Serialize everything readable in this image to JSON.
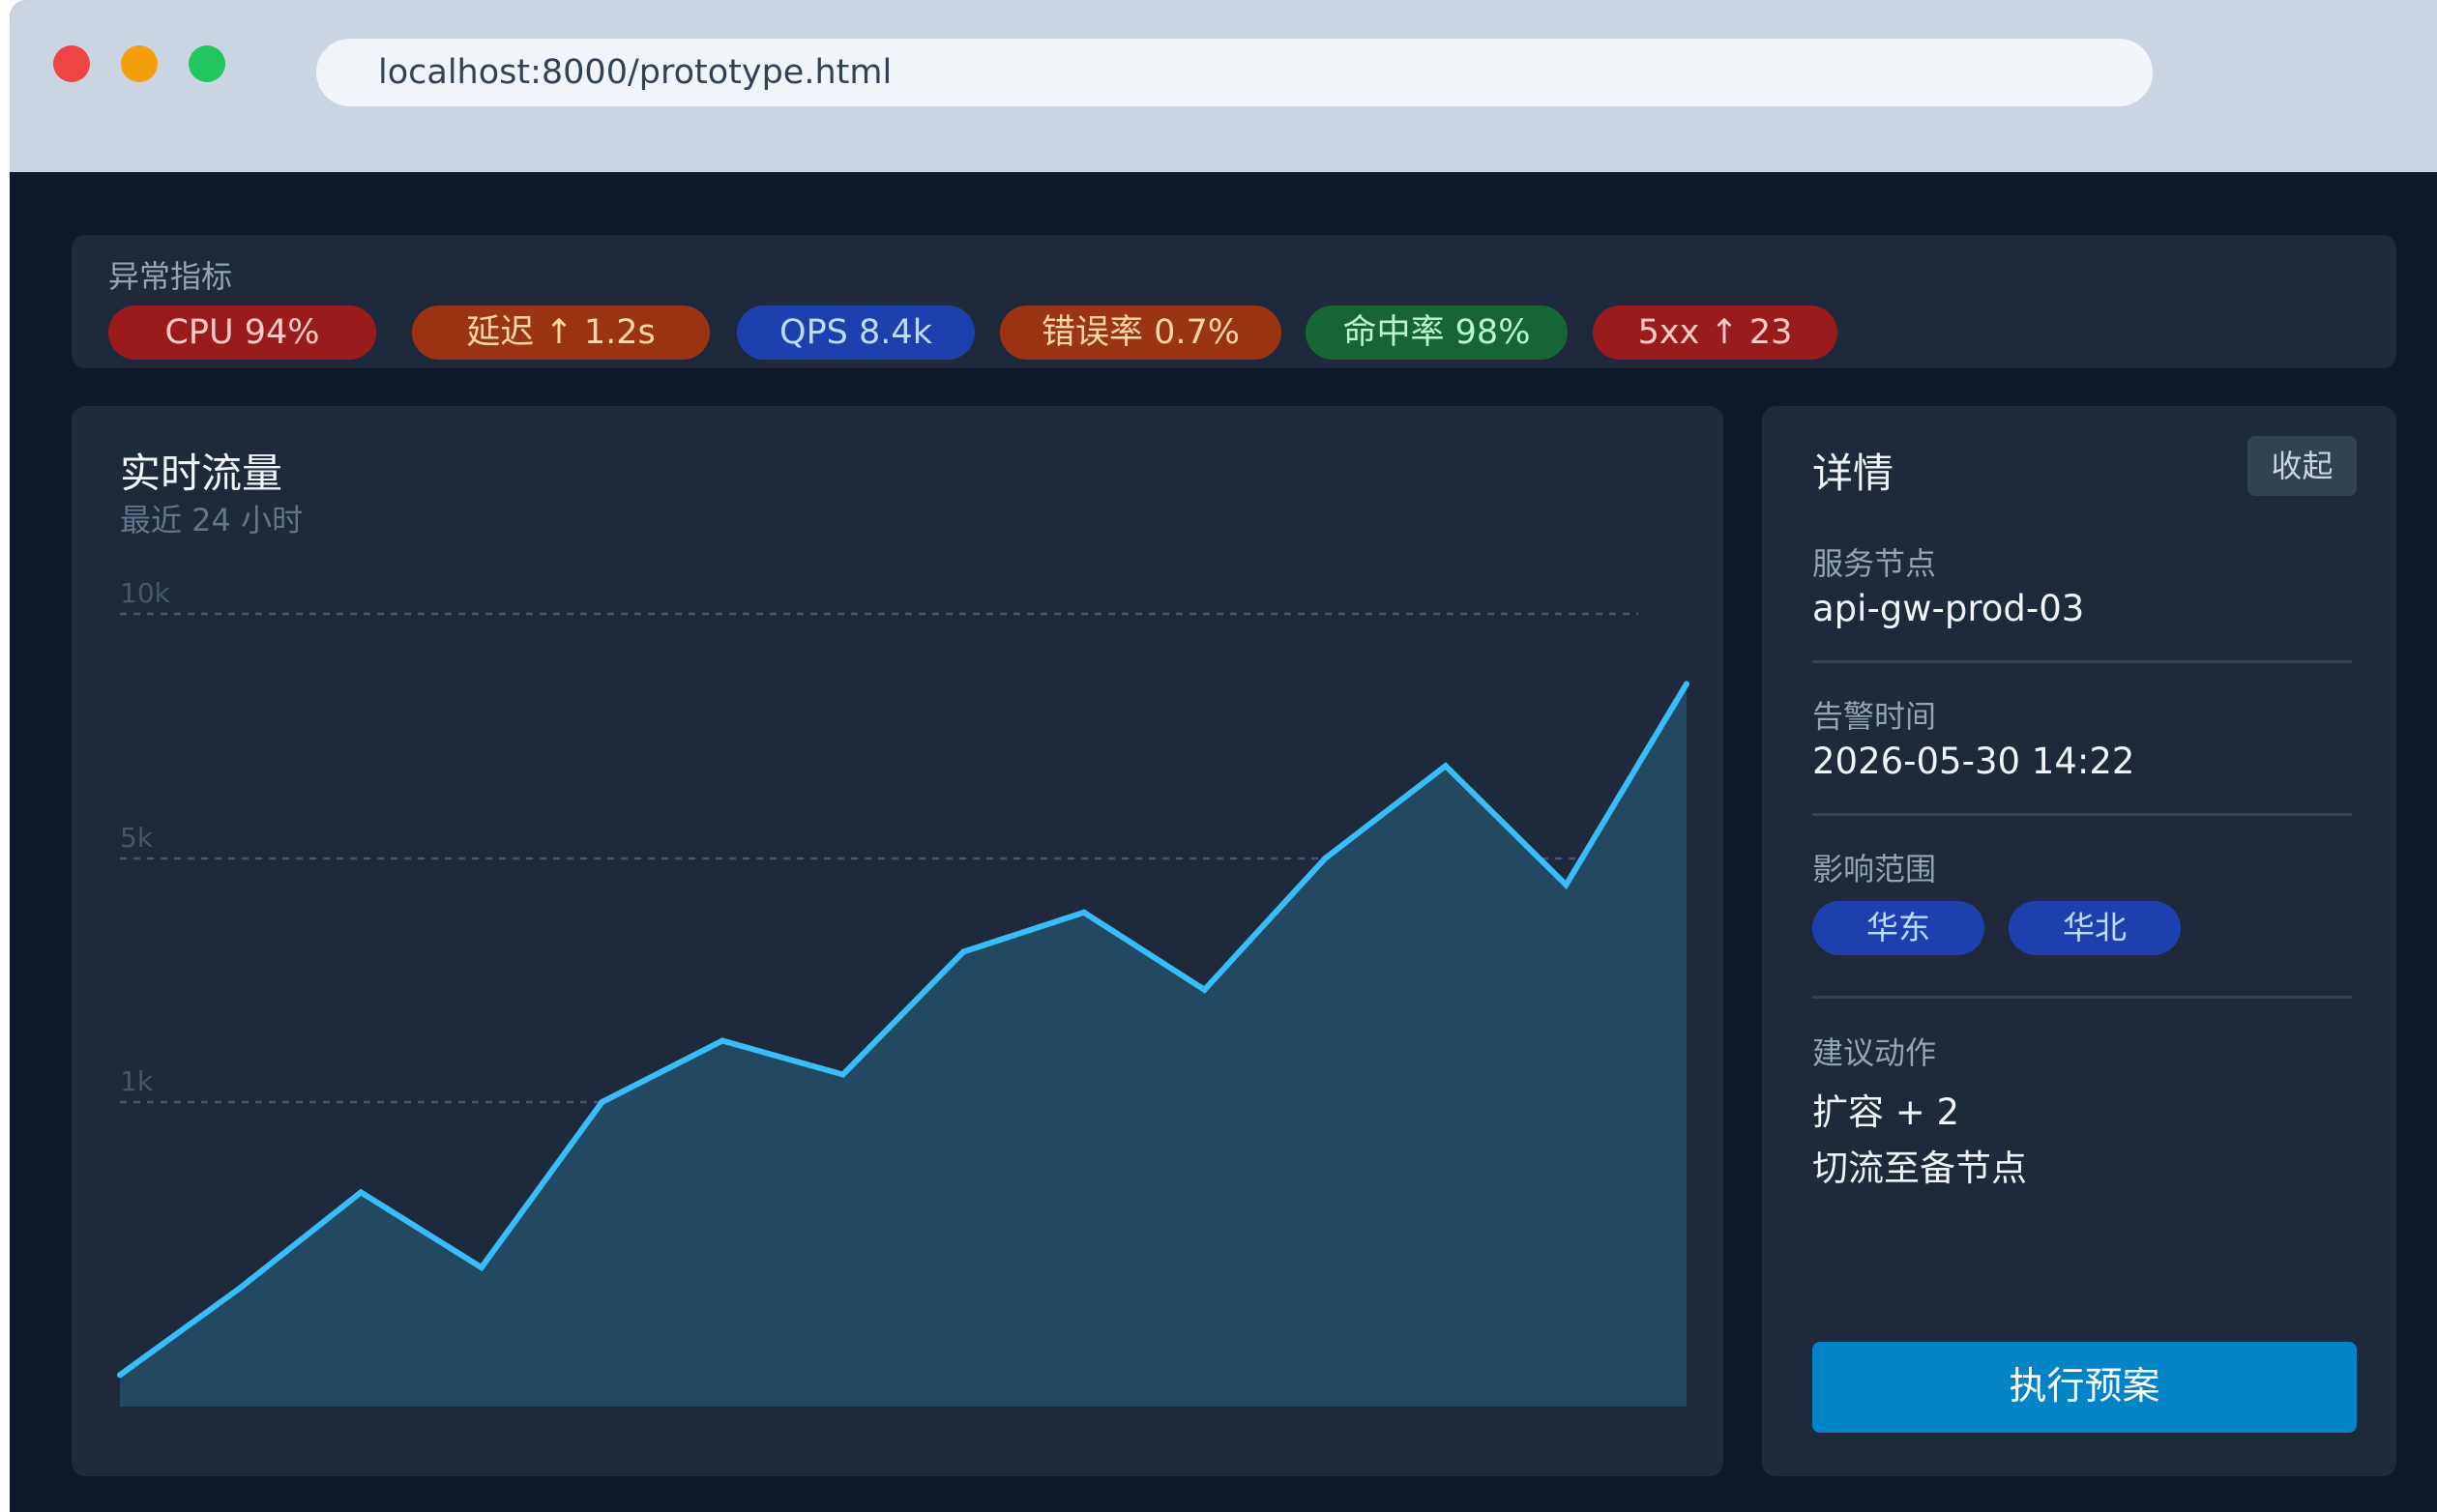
{
  "browser": {
    "url": "localhost:8000/prototype.html"
  },
  "anomaly": {
    "title": "异常指标",
    "chips": [
      {
        "label": "CPU 94%",
        "color": "#991b1b"
      },
      {
        "label": "延迟 ↑ 1.2s",
        "color": "#9a3412"
      },
      {
        "label": "QPS 8.4k",
        "color": "#1e40af"
      },
      {
        "label": "错误率 0.7%",
        "color": "#9a3412"
      },
      {
        "label": "命中率 98%",
        "color": "#166534"
      },
      {
        "label": "5xx ↑ 23",
        "color": "#991b1b"
      }
    ]
  },
  "traffic": {
    "title": "实时流量",
    "subtitle": "最近 24 小时"
  },
  "chart_data": {
    "type": "area",
    "title": "实时流量",
    "subtitle": "最近 24 小时",
    "y_ticks": [
      "10k",
      "5k",
      "1k"
    ],
    "y_scale": "log",
    "ylim": [
      300,
      10000
    ],
    "grid": true,
    "line_color": "#38bdf8",
    "fill_color": "#234862",
    "x": [
      0,
      1,
      2,
      3,
      4,
      5,
      6,
      7,
      8,
      9,
      10,
      11,
      12,
      13
    ],
    "values": [
      340,
      480,
      700,
      520,
      1000,
      1500,
      1200,
      2700,
      3500,
      2100,
      5000,
      6500,
      4200,
      8200
    ]
  },
  "detail": {
    "title": "详情",
    "collapse": "收起",
    "node_label": "服务节点",
    "node_value": "api-gw-prod-03",
    "time_label": "告警时间",
    "time_value": "2026-05-30 14:22",
    "scope_label": "影响范围",
    "regions": [
      "华东",
      "华北"
    ],
    "action_label": "建议动作",
    "actions": [
      "扩容 + 2",
      "切流至备节点"
    ],
    "execute": "执行预案"
  }
}
